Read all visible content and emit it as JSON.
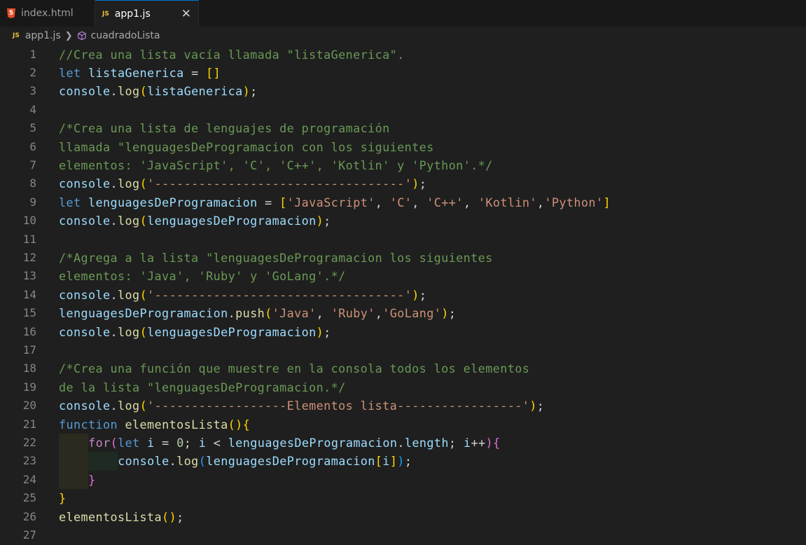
{
  "tabs": [
    {
      "label": "index.html",
      "icon": "html5-icon",
      "active": false
    },
    {
      "label": "app1.js",
      "icon": "js-icon",
      "active": true,
      "close": "✕"
    }
  ],
  "file_icon_text": "JS",
  "html_icon_text": "5",
  "breadcrumb": {
    "file": "app1.js",
    "symbol": "cuadradoLista"
  },
  "code_lines": [
    "//Crea una lista vacía llamada \"listaGenerica\".",
    "let listaGenerica = []",
    "console.log(listaGenerica);",
    "",
    "/*Crea una lista de lenguajes de programación",
    "llamada \"lenguagesDeProgramacion con los siguientes",
    "elementos: 'JavaScript', 'C', 'C++', 'Kotlin' y 'Python'.*/",
    "console.log('----------------------------------');",
    "let lenguagesDeProgramacion = ['JavaScript', 'C', 'C++', 'Kotlin','Python']",
    "console.log(lenguagesDeProgramacion);",
    "",
    "/*Agrega a la lista \"lenguagesDeProgramacion los siguientes",
    "elementos: 'Java', 'Ruby' y 'GoLang'.*/",
    "console.log('----------------------------------');",
    "lenguagesDeProgramacion.push('Java', 'Ruby','GoLang');",
    "console.log(lenguagesDeProgramacion);",
    "",
    "/*Crea una función que muestre en la consola todos los elementos",
    "de la lista \"lenguagesDeProgramacion.*/",
    "console.log('------------------Elementos lista-----------------');",
    "function elementosLista(){",
    "    for(let i = 0; i < lenguagesDeProgramacion.length; i++){",
    "        console.log(lenguagesDeProgramacion[i]);",
    "    }",
    "}",
    "elementosLista();",
    ""
  ],
  "colors": {
    "background": "#1f1f1f",
    "comment": "#6a9955",
    "keyword": "#569cd6",
    "variable": "#9cdcfe",
    "function": "#dcdcaa",
    "string": "#ce9178",
    "number": "#b5cea8",
    "control": "#c586c0",
    "bracket_1": "#ffd700",
    "bracket_2": "#da70d6",
    "bracket_3": "#179fff"
  }
}
